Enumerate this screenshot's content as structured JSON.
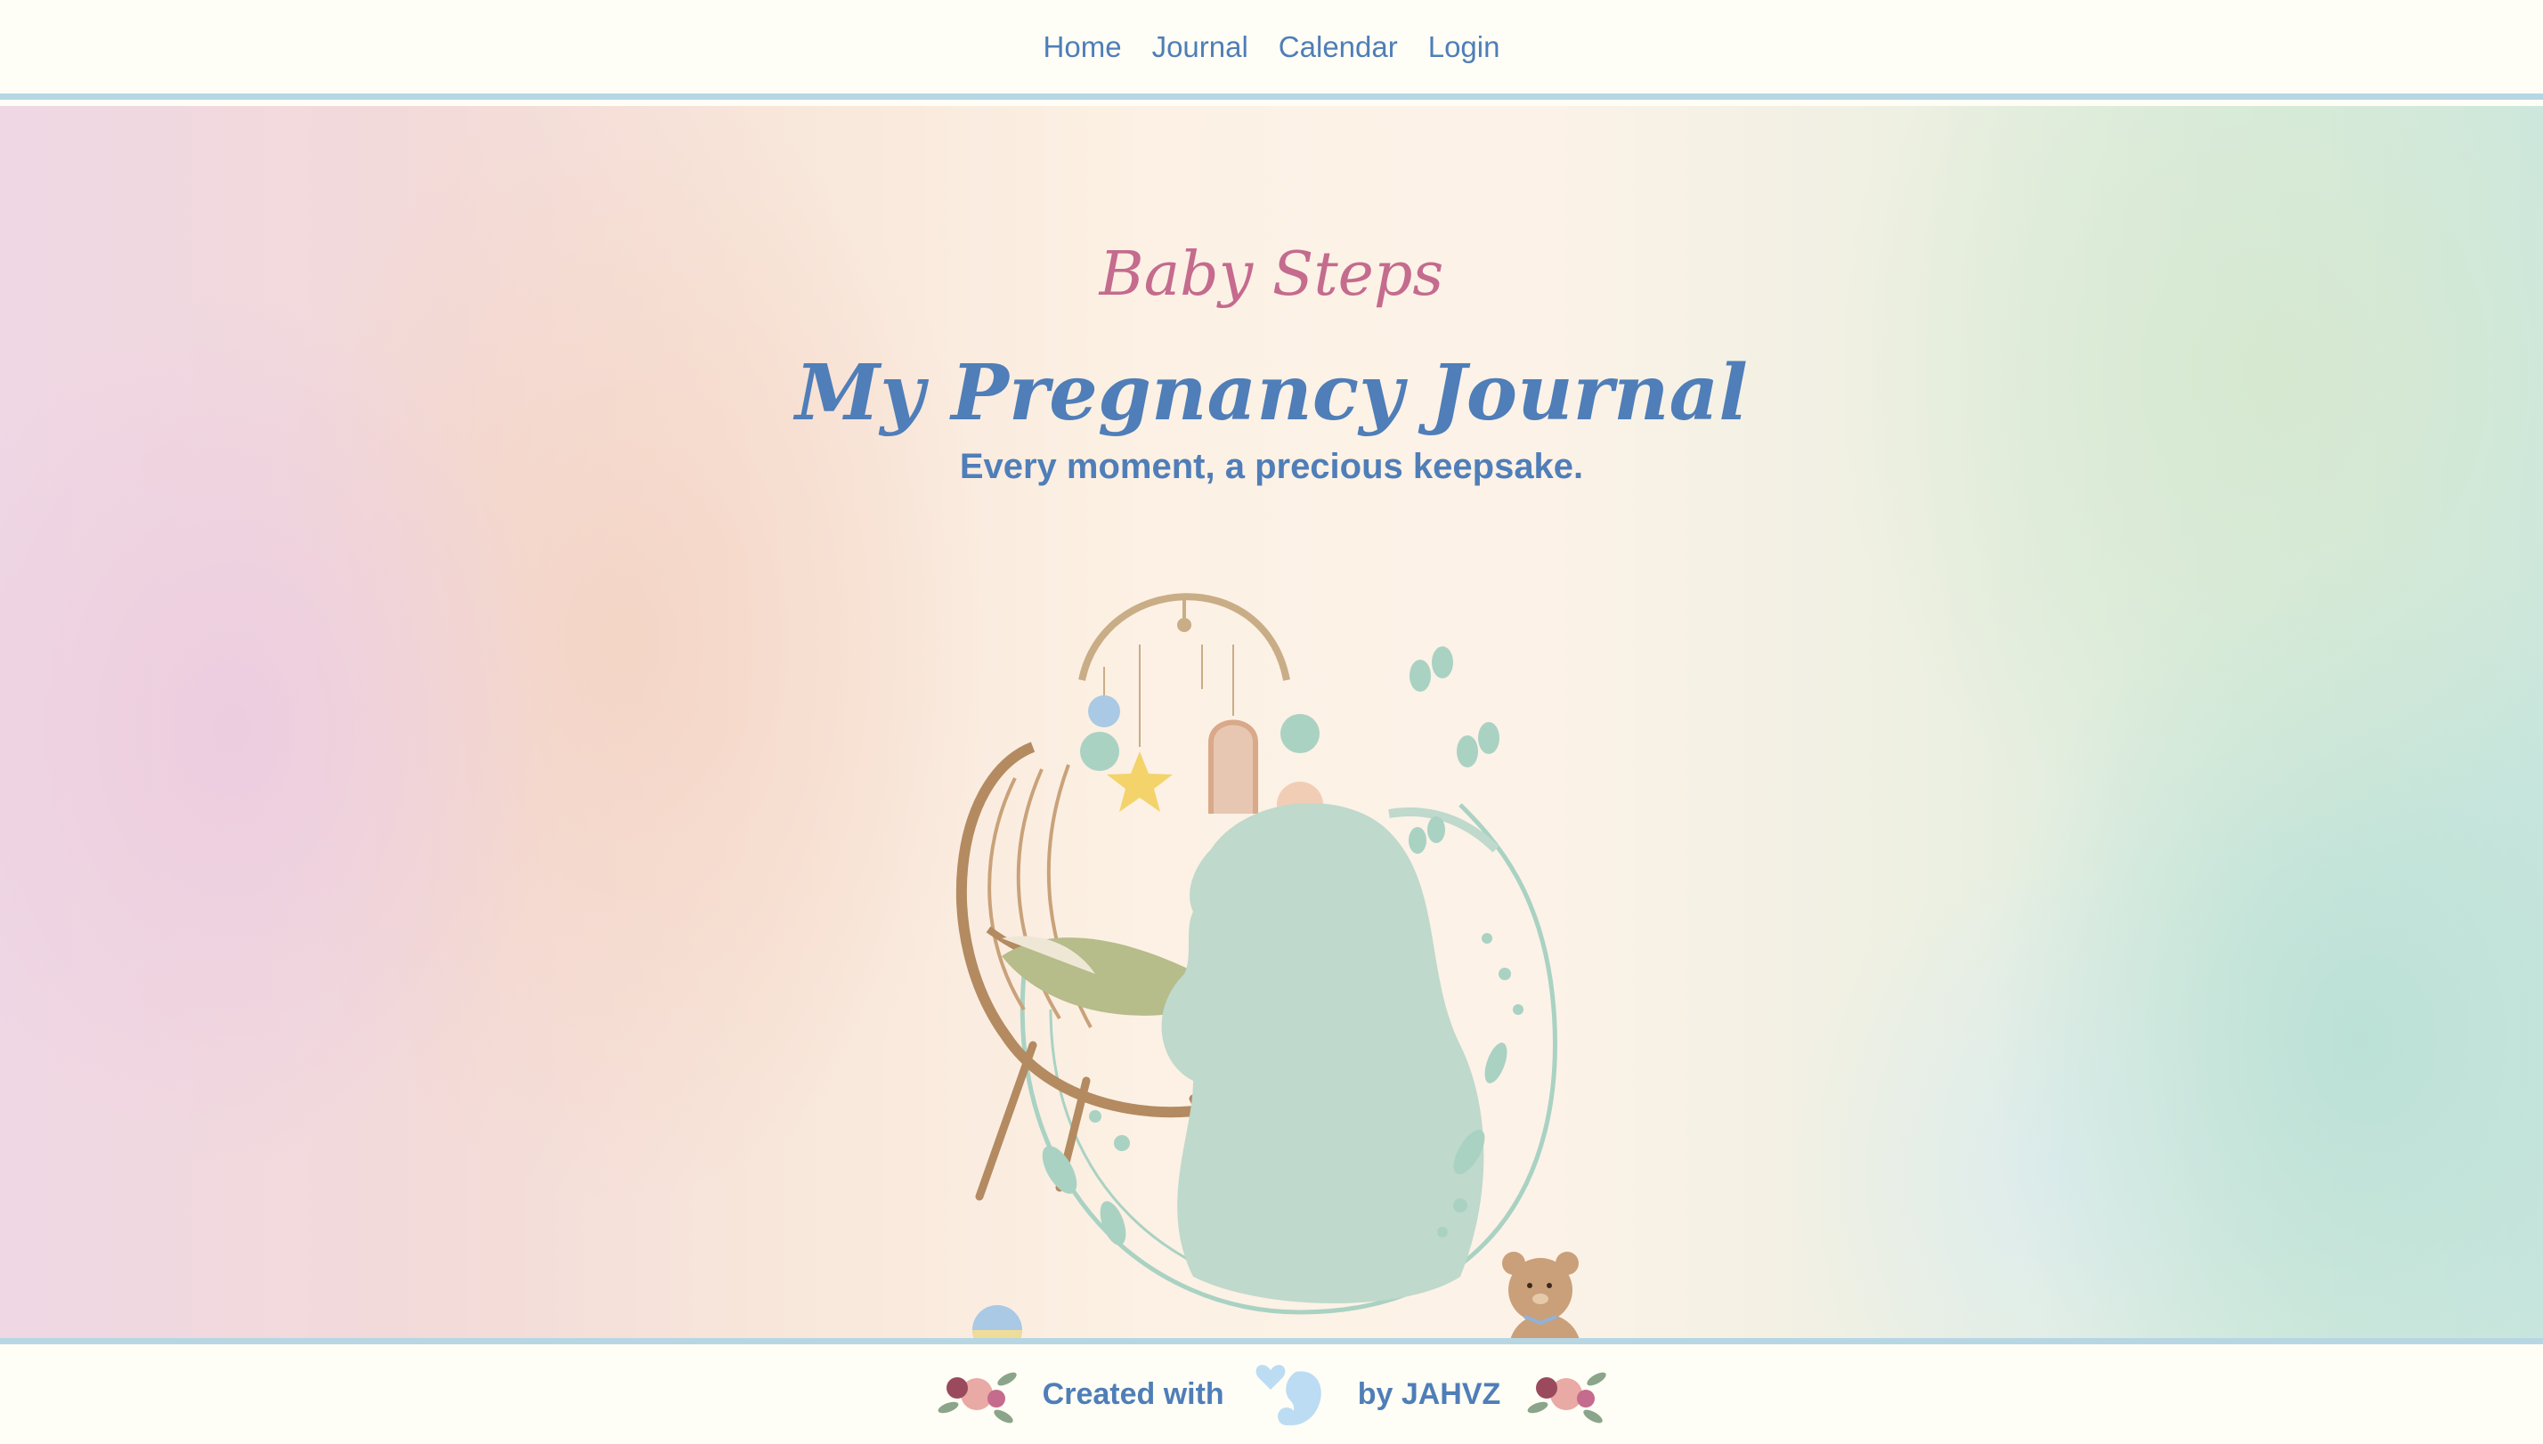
{
  "nav": {
    "items": [
      {
        "label": "Home"
      },
      {
        "label": "Journal"
      },
      {
        "label": "Calendar"
      },
      {
        "label": "Login"
      }
    ]
  },
  "hero": {
    "brand": "Baby Steps",
    "title": "My Pregnancy Journal",
    "tagline": "Every moment, a precious keepsake."
  },
  "footer": {
    "created_with": "Created with",
    "by": "by JAHVZ"
  },
  "colors": {
    "accent_blue": "#4f7eb8",
    "brand_pink": "#c46b8e",
    "border_blue": "#b6d6e4",
    "background": "#fefef6"
  },
  "icons": [
    "flower-bouquet-icon",
    "baby-heart-icon",
    "flower-bouquet-icon"
  ]
}
